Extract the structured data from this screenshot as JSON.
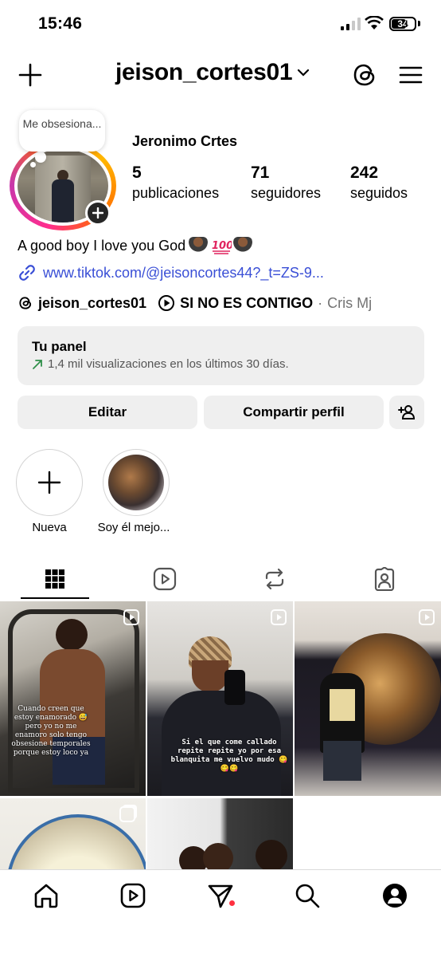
{
  "status_bar": {
    "time": "15:46",
    "battery": "34"
  },
  "header": {
    "username": "jeison_cortes01"
  },
  "note": {
    "text": "Me obsesiona..."
  },
  "profile": {
    "display_name": "Jeronimo Crtes",
    "stats": [
      {
        "value": "5",
        "label": "publicaciones"
      },
      {
        "value": "71",
        "label": "seguidores"
      },
      {
        "value": "242",
        "label": "seguidos"
      }
    ],
    "bio": "A good boy I love you God",
    "bio_emojis": [
      "person-bowing-emoji",
      "hundred-points-emoji",
      "person-bowing-emoji"
    ],
    "link": "www.tiktok.com/@jeisoncortes44?_t=ZS-9...",
    "threads_handle": "jeison_cortes01",
    "music_title": "SI NO ES CONTIGO",
    "music_separator": "·",
    "music_artist": "Cris Mj"
  },
  "panel": {
    "title": "Tu panel",
    "subtitle": "1,4 mil visualizaciones en los últimos 30 días."
  },
  "buttons": {
    "edit": "Editar",
    "share": "Compartir perfil"
  },
  "highlights": [
    {
      "label": "Nueva"
    },
    {
      "label": "Soy él mejo..."
    }
  ],
  "tabs": [
    "grid-icon",
    "reels-icon",
    "reposts-icon",
    "tagged-icon"
  ],
  "posts": [
    {
      "type": "reel",
      "caption": "Cuando creen que estoy enamorado 😅 pero yo no me enamoro solo tengo obsesione temporales porque estoy loco ya"
    },
    {
      "type": "reel",
      "caption": "Si el que come callado repite repite yo por esa blanquita me vuelvo mudo 😋😋😋"
    },
    {
      "type": "reel",
      "caption": ""
    },
    {
      "type": "carousel",
      "caption": ""
    },
    {
      "type": "photo",
      "caption": ""
    }
  ],
  "bottom_nav": [
    "home-icon",
    "reels-icon",
    "messages-icon",
    "search-icon",
    "profile-icon"
  ],
  "colors": {
    "link": "#3a4fd6",
    "button_bg": "#efefef",
    "notification": "#ff3040"
  }
}
